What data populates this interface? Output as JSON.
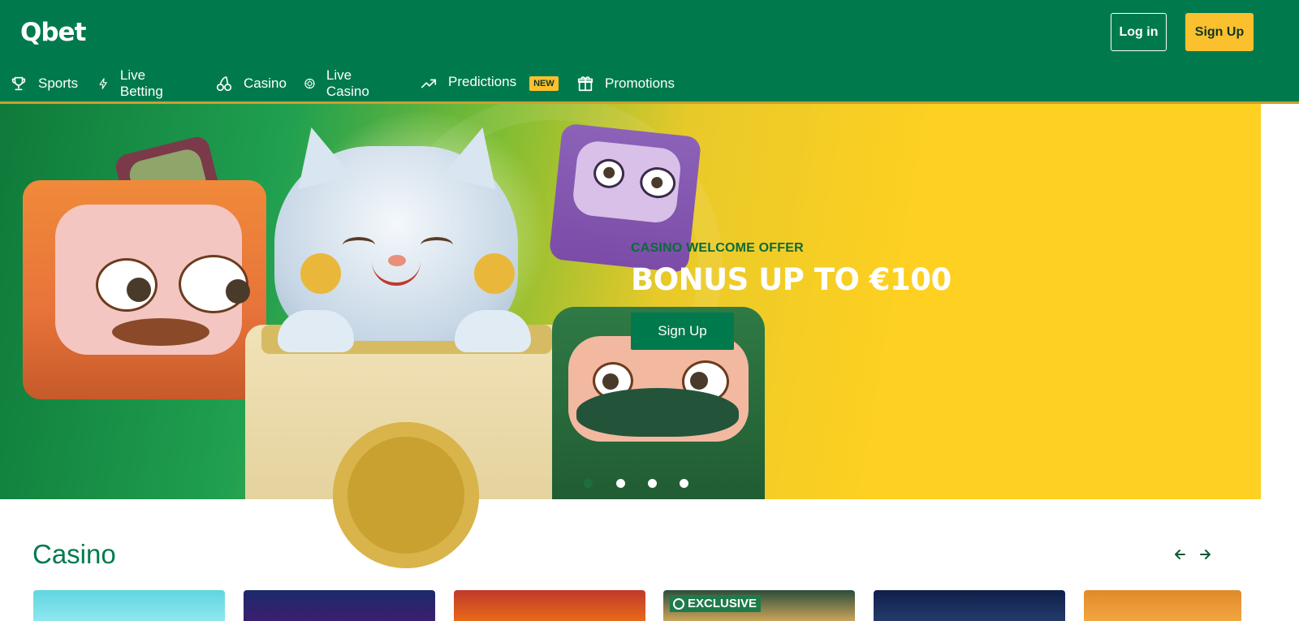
{
  "header": {
    "logo": "Qbet",
    "login_label": "Log in",
    "signup_label": "Sign Up"
  },
  "nav": {
    "items": [
      {
        "label": "Sports",
        "icon": "trophy-icon"
      },
      {
        "label": "Live Betting",
        "icon": "lightning-icon"
      },
      {
        "label": "Casino",
        "icon": "cherries-icon"
      },
      {
        "label": "Live Casino",
        "icon": "chip-icon"
      },
      {
        "label": "Predictions",
        "icon": "trending-up-icon",
        "badge": "NEW"
      },
      {
        "label": "Promotions",
        "icon": "gift-icon"
      }
    ]
  },
  "hero": {
    "eyebrow": "CASINO WELCOME OFFER",
    "title": "BONUS UP TO €100",
    "cta_label": "Sign Up",
    "slides": 4,
    "active_slide": 1
  },
  "casino": {
    "title": "Casino",
    "tiles": [
      {
        "colors": [
          "#5fd6e0",
          "#8fe7ee"
        ]
      },
      {
        "colors": [
          "#1b2a6b",
          "#3b1f6e"
        ]
      },
      {
        "colors": [
          "#c0392b",
          "#e86a1a"
        ]
      },
      {
        "colors": [
          "#2c4d3a",
          "#caa45a"
        ],
        "tag": "EXCLUSIVE"
      },
      {
        "colors": [
          "#0f1f4a",
          "#243b6a"
        ]
      },
      {
        "colors": [
          "#e08a2a",
          "#f2a640"
        ]
      }
    ]
  },
  "colors": {
    "brand_green": "#007a4d",
    "brand_yellow": "#fbc02d"
  }
}
